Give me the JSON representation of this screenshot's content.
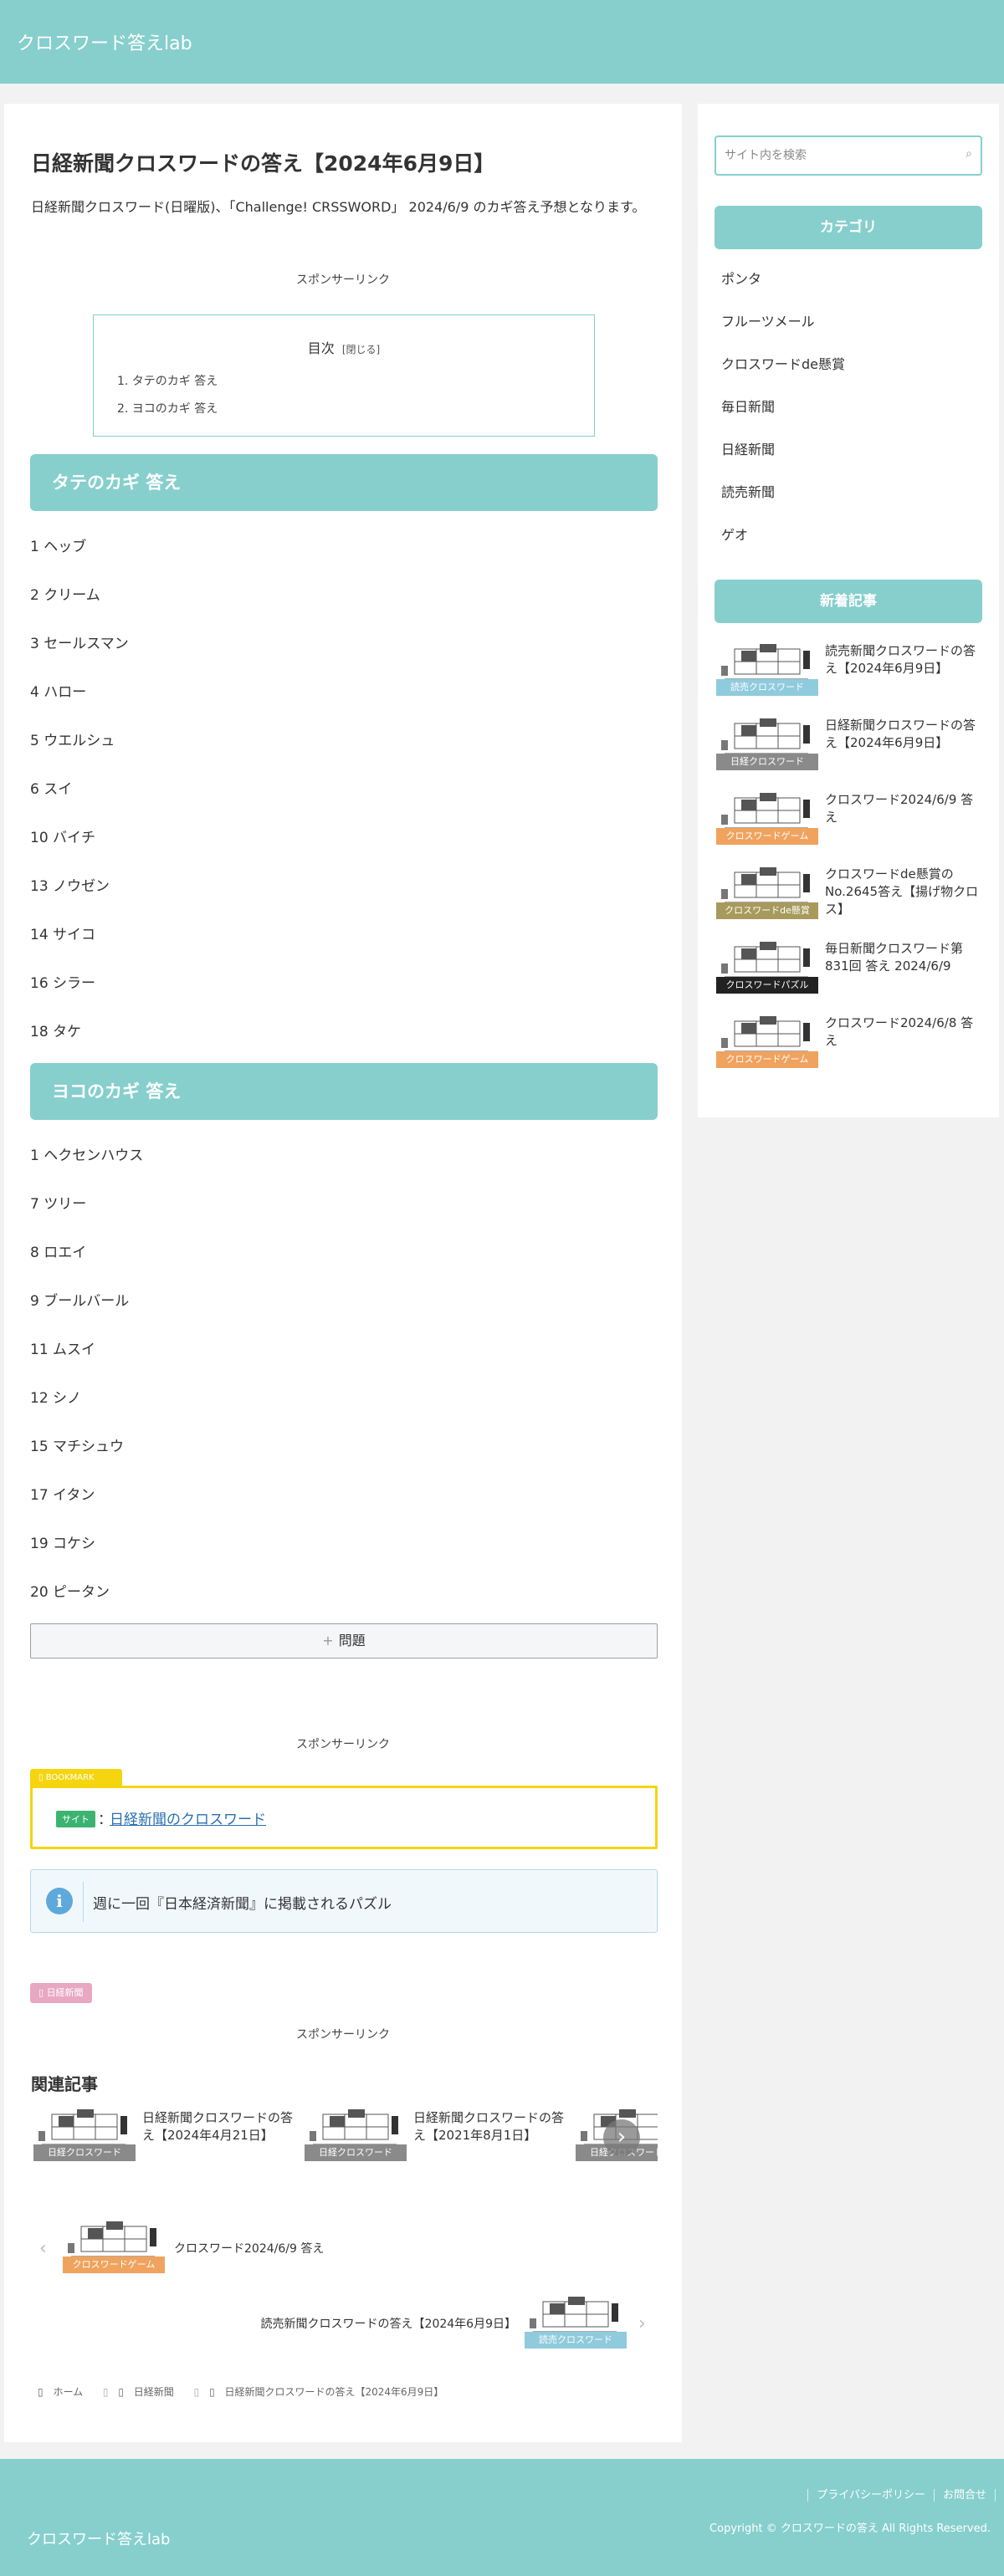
{
  "site": {
    "title": "クロスワード答えlab"
  },
  "post": {
    "title": "日経新聞クロスワードの答え【2024年6月9日】",
    "intro": "日経新聞クロスワード(日曜版)、「Challenge! CRSSWORD」 2024/6/9 のカギ答え予想となります。"
  },
  "sponsor_label": "スポンサーリンク",
  "toc": {
    "title": "目次",
    "toggle": "[閉じる]",
    "items": [
      "1. タテのカギ 答え",
      "2. ヨコのカギ 答え"
    ]
  },
  "tate": {
    "heading": "タテのカギ 答え",
    "items": [
      "1 ヘッブ",
      "2 クリーム",
      "3 セールスマン",
      "4 ハロー",
      "5 ウエルシュ",
      "6 スイ",
      "10 バイチ",
      "13 ノウゼン",
      "14 サイコ",
      "16 シラー",
      "18 タケ"
    ]
  },
  "yoko": {
    "heading": "ヨコのカギ 答え",
    "items": [
      "1 ヘクセンハウス",
      "7 ツリー",
      "8 ロエイ",
      "9 ブールバール",
      "11 ムスイ",
      "12 シノ",
      "15 マチシュウ",
      "17 イタン",
      "19 コケシ",
      "20 ピータン"
    ]
  },
  "more_button": {
    "icon": "+",
    "label": "問題"
  },
  "bookmark": {
    "tab": "BOOKMARK",
    "badge": "サイト",
    "colon": "：",
    "link": "日経新聞のクロスワード"
  },
  "info": {
    "icon": "i",
    "text": "週に一回『日本経済新聞』に掲載されるパズル"
  },
  "category_tag": "日経新聞",
  "related": {
    "title": "関連記事",
    "items": [
      {
        "label": "日経クロスワード",
        "text": "日経新聞クロスワードの答え【2024年4月21日】"
      },
      {
        "label": "日経クロスワード",
        "text": "日経新聞クロスワードの答え【2021年8月1日】"
      },
      {
        "label": "日経クロスワード",
        "text": ""
      }
    ],
    "next_arrow": "›"
  },
  "prev_post": {
    "chevron": "‹",
    "label": "クロスワードゲーム",
    "text": "クロスワード2024/6/9 答え"
  },
  "next_post": {
    "chevron": "›",
    "label": "読売クロスワード",
    "text": "読売新聞クロスワードの答え【2024年6月9日】"
  },
  "breadcrumb": {
    "home": "ホーム",
    "category": "日経新聞",
    "current": "日経新聞クロスワードの答え【2024年6月9日】"
  },
  "sidebar": {
    "search_placeholder": "サイト内を検索",
    "categories_heading": "カテゴリ",
    "categories": [
      "ポンタ",
      "フルーツメール",
      "クロスワードde懸賞",
      "毎日新聞",
      "日経新聞",
      "読売新聞",
      "ゲオ"
    ],
    "new_heading": "新着記事",
    "new_posts": [
      {
        "label": "読売クロスワード",
        "text": "読売新聞クロスワードの答え【2024年6月9日】"
      },
      {
        "label": "日経クロスワード",
        "text": "日経新聞クロスワードの答え【2024年6月9日】"
      },
      {
        "label": "クロスワードゲーム",
        "text": "クロスワード2024/6/9 答え"
      },
      {
        "label": "クロスワードde懸賞",
        "text": "クロスワードde懸賞のNo.2645答え【揚げ物クロス】"
      },
      {
        "label": "クロスワードパズル",
        "text": "毎日新聞クロスワード第831回 答え 2024/6/9"
      },
      {
        "label": "クロスワードゲーム",
        "text": "クロスワード2024/6/8 答え"
      }
    ]
  },
  "footer": {
    "title": "クロスワード答えlab",
    "links": [
      "プライバシーポリシー",
      "お問合せ"
    ],
    "copyright": "Copyright © クロスワードの答え All Rights Reserved."
  },
  "colors": {
    "accent": "#86cfcd",
    "label_yomiuri": "#8fcbdd",
    "label_nikkei": "#8a8a8a",
    "label_game": "#f0a35e",
    "label_kensho": "#a89a5c",
    "label_puzzle": "#222222",
    "bookmark": "#f4d50f"
  }
}
